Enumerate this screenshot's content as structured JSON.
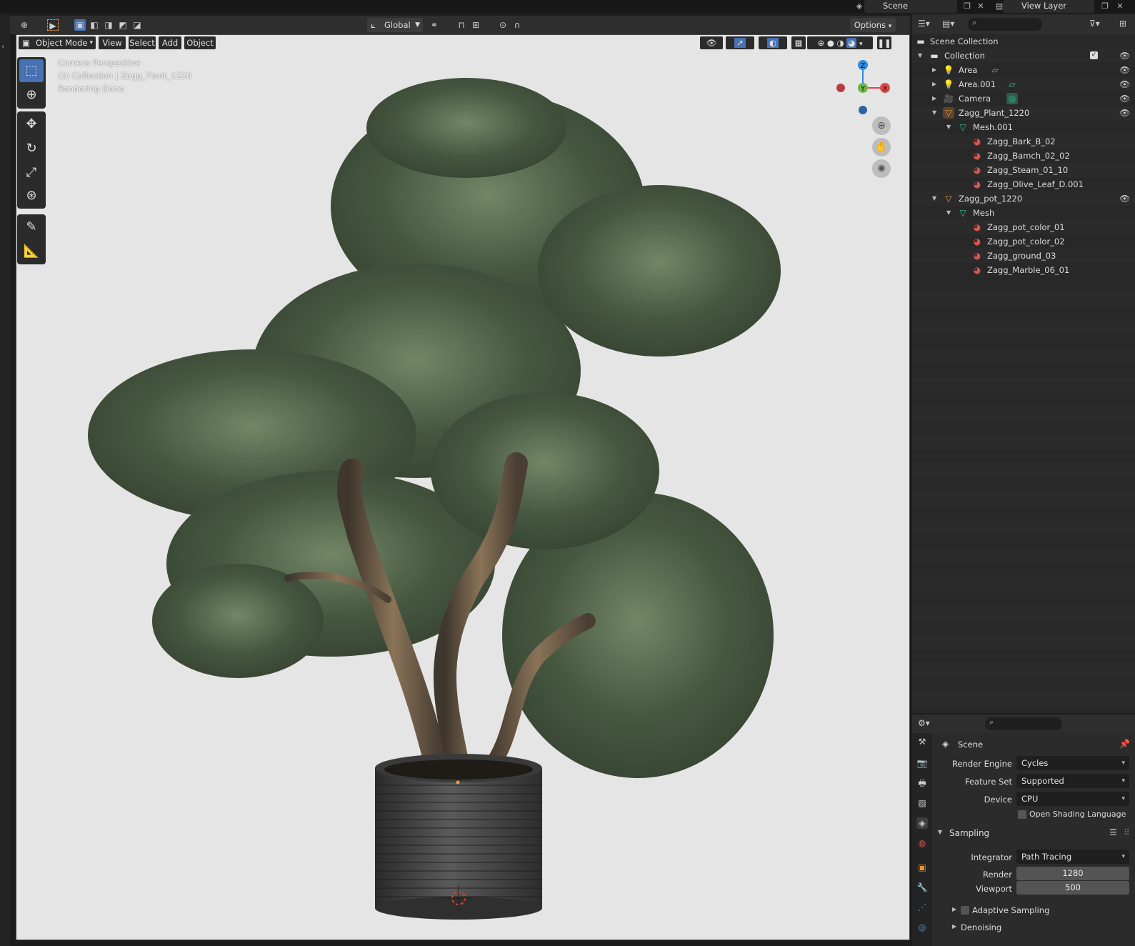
{
  "topbar": {
    "scene_label": "Scene",
    "view_layer_label": "View Layer"
  },
  "header": {
    "transform_orientation": "Global",
    "options_label": "Options"
  },
  "viewport_menu": {
    "mode": "Object Mode",
    "view": "View",
    "select": "Select",
    "add": "Add",
    "object": "Object"
  },
  "viewport_overlay": {
    "line1": "Camera Perspective",
    "line2": "(1) Collection | Zagg_Plant_1220",
    "line3": "Rendering Done"
  },
  "gizmo": {
    "z": "Z",
    "y": "Y",
    "x": "X"
  },
  "outliner": {
    "root": "Scene Collection",
    "items": [
      {
        "label": "Collection"
      },
      {
        "label": "Area"
      },
      {
        "label": "Area.001"
      },
      {
        "label": "Camera"
      },
      {
        "label": "Zagg_Plant_1220"
      },
      {
        "label": "Mesh.001"
      },
      {
        "label": "Zagg_Bark_B_02"
      },
      {
        "label": "Zagg_Bamch_02_02"
      },
      {
        "label": "Zagg_Steam_01_10"
      },
      {
        "label": "Zagg_Olive_Leaf_D.001"
      },
      {
        "label": "Zagg_pot_1220"
      },
      {
        "label": "Mesh"
      },
      {
        "label": "Zagg_pot_color_01"
      },
      {
        "label": "Zagg_pot_color_02"
      },
      {
        "label": "Zagg_ground_03"
      },
      {
        "label": "Zagg_Marble_06_01"
      }
    ]
  },
  "properties": {
    "context": "Scene",
    "render_engine_label": "Render Engine",
    "render_engine": "Cycles",
    "feature_set_label": "Feature Set",
    "feature_set": "Supported",
    "device_label": "Device",
    "device": "CPU",
    "osl_label": "Open Shading Language",
    "sampling_label": "Sampling",
    "integrator_label": "Integrator",
    "integrator": "Path Tracing",
    "render_label": "Render",
    "render_samples": "1280",
    "viewport_label": "Viewport",
    "viewport_samples": "500",
    "adaptive_label": "Adaptive Sampling",
    "denoising_label": "Denoising"
  },
  "colors": {
    "accent": "#4772b3",
    "viewport_bg": "#e5e5e5",
    "object_orange": "#e8953a",
    "mesh_green": "#3fbf93",
    "material_red": "#d9534f"
  }
}
